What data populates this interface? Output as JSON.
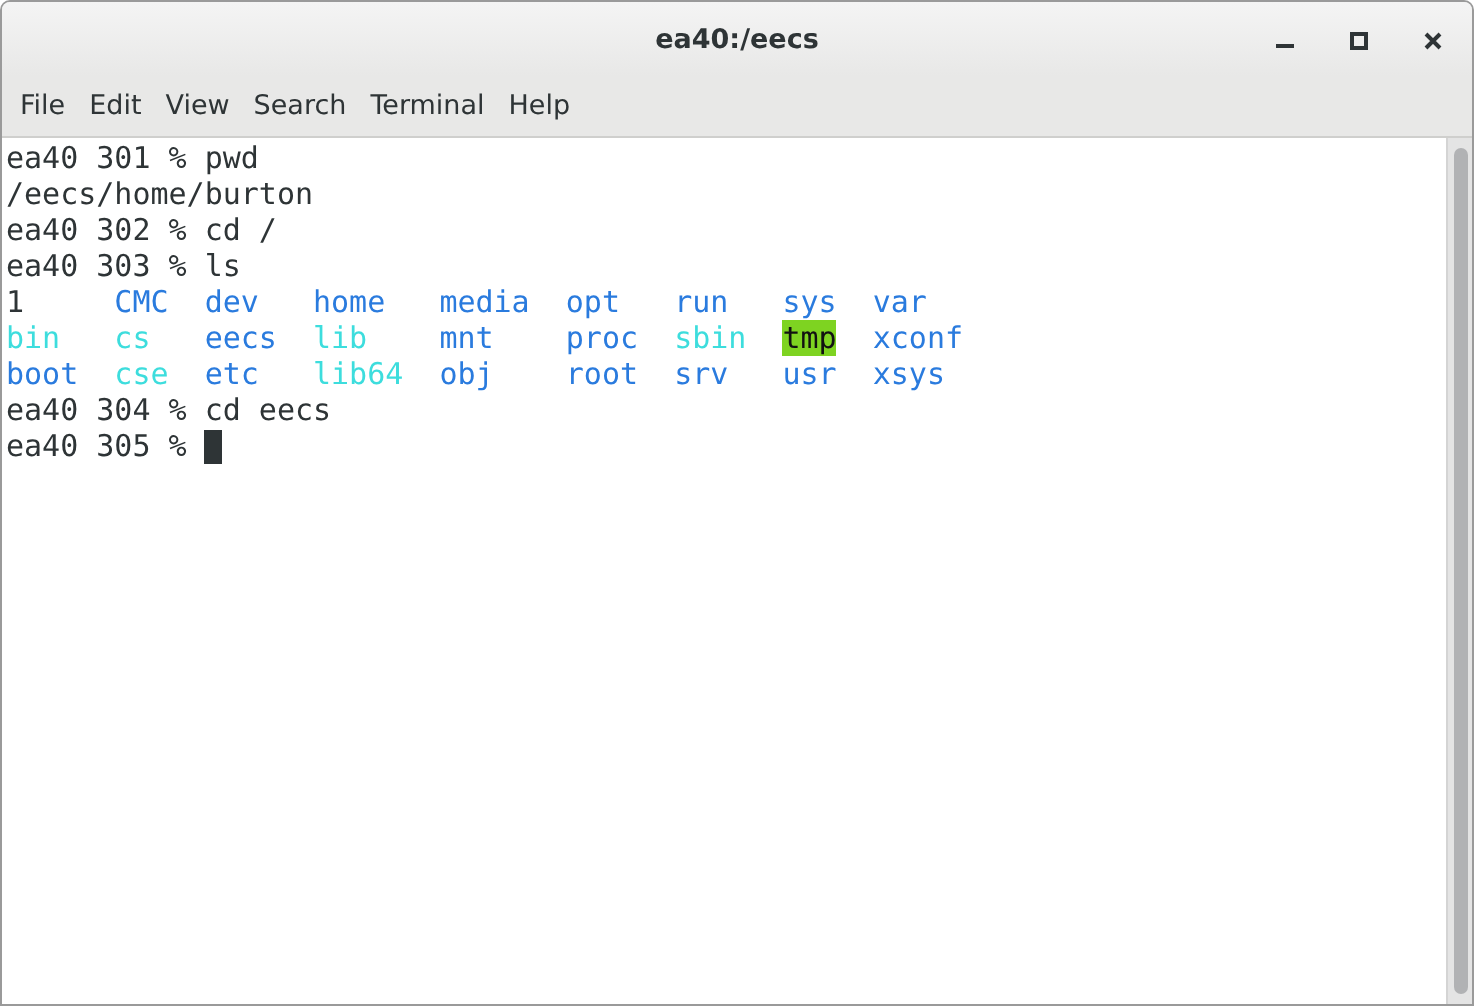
{
  "window": {
    "title": "ea40:/eecs"
  },
  "menu": [
    "File",
    "Edit",
    "View",
    "Search",
    "Terminal",
    "Help"
  ],
  "terminal": {
    "lines": [
      {
        "kind": "text",
        "text": "ea40 301 % pwd"
      },
      {
        "kind": "text",
        "text": "/eecs/home/burton"
      },
      {
        "kind": "text",
        "text": "ea40 302 % cd /"
      },
      {
        "kind": "text",
        "text": "ea40 303 % ls"
      },
      {
        "kind": "listing",
        "entries": [
          {
            "text": "1",
            "kind": "file"
          },
          {
            "text": "CMC",
            "kind": "dir"
          },
          {
            "text": "dev",
            "kind": "dir"
          },
          {
            "text": "home",
            "kind": "dir"
          },
          {
            "text": "media",
            "kind": "dir"
          },
          {
            "text": "opt",
            "kind": "dir"
          },
          {
            "text": "run",
            "kind": "dir"
          },
          {
            "text": "sys",
            "kind": "dir"
          },
          {
            "text": "var",
            "kind": "dir"
          }
        ]
      },
      {
        "kind": "listing",
        "entries": [
          {
            "text": "bin",
            "kind": "link"
          },
          {
            "text": "cs",
            "kind": "link"
          },
          {
            "text": "eecs",
            "kind": "dir"
          },
          {
            "text": "lib",
            "kind": "link"
          },
          {
            "text": "mnt",
            "kind": "dir"
          },
          {
            "text": "proc",
            "kind": "dir"
          },
          {
            "text": "sbin",
            "kind": "link"
          },
          {
            "text": "tmp",
            "kind": "sticky"
          },
          {
            "text": "xconf",
            "kind": "dir"
          }
        ]
      },
      {
        "kind": "listing",
        "entries": [
          {
            "text": "boot",
            "kind": "dir"
          },
          {
            "text": "cse",
            "kind": "link"
          },
          {
            "text": "etc",
            "kind": "dir"
          },
          {
            "text": "lib64",
            "kind": "link"
          },
          {
            "text": "obj",
            "kind": "dir"
          },
          {
            "text": "root",
            "kind": "dir"
          },
          {
            "text": "srv",
            "kind": "dir"
          },
          {
            "text": "usr",
            "kind": "dir"
          },
          {
            "text": "xsys",
            "kind": "dir"
          }
        ]
      },
      {
        "kind": "text",
        "text": "ea40 304 % cd eecs"
      },
      {
        "kind": "prompt",
        "text": "ea40 305 % "
      }
    ]
  }
}
